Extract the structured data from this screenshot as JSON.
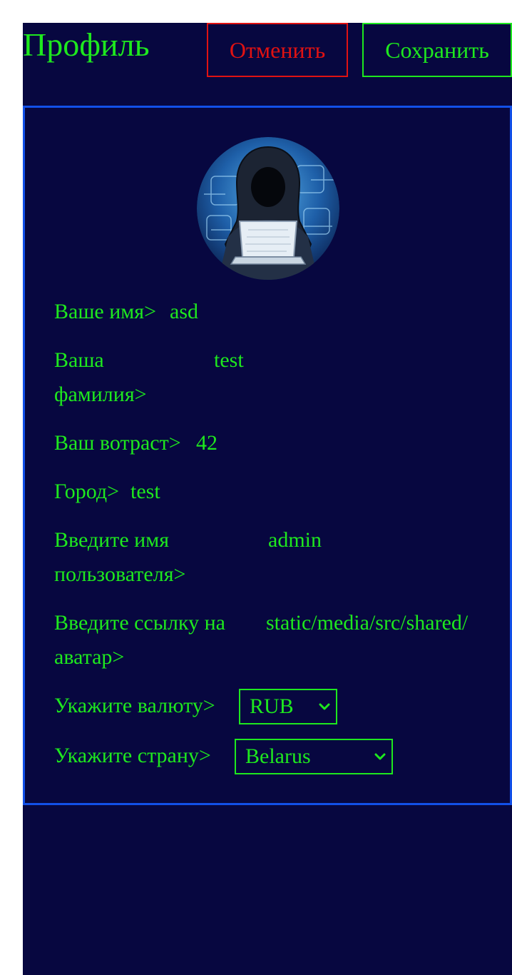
{
  "header": {
    "title": "Профиль",
    "cancel_label": "Отменить",
    "save_label": "Сохранить"
  },
  "profile": {
    "avatar_icon": "hooded-hacker-avatar",
    "first_name": {
      "label": "Ваше имя>",
      "value": "asd"
    },
    "last_name": {
      "label_line1": "Ваша",
      "label_line2": "фамилия>",
      "value": "test"
    },
    "age": {
      "label": "Ваш вотраст>",
      "value": "42"
    },
    "city": {
      "label": "Город>",
      "value": "test"
    },
    "username": {
      "label_line1": "Введите имя",
      "label_line2": "пользователя>",
      "value": "admin"
    },
    "avatar_link": {
      "label_line1": "Введите ссылку на",
      "label_line2": "аватар>",
      "value": "static/media/src/shared/"
    },
    "currency": {
      "label": "Укажите валюту>",
      "selected": "RUB"
    },
    "country": {
      "label": "Укажите страну>",
      "selected": "Belarus"
    }
  },
  "colors": {
    "background": "#070740",
    "text": "#1ee81e",
    "cancel": "#e01212",
    "card_border": "#1250e8"
  }
}
